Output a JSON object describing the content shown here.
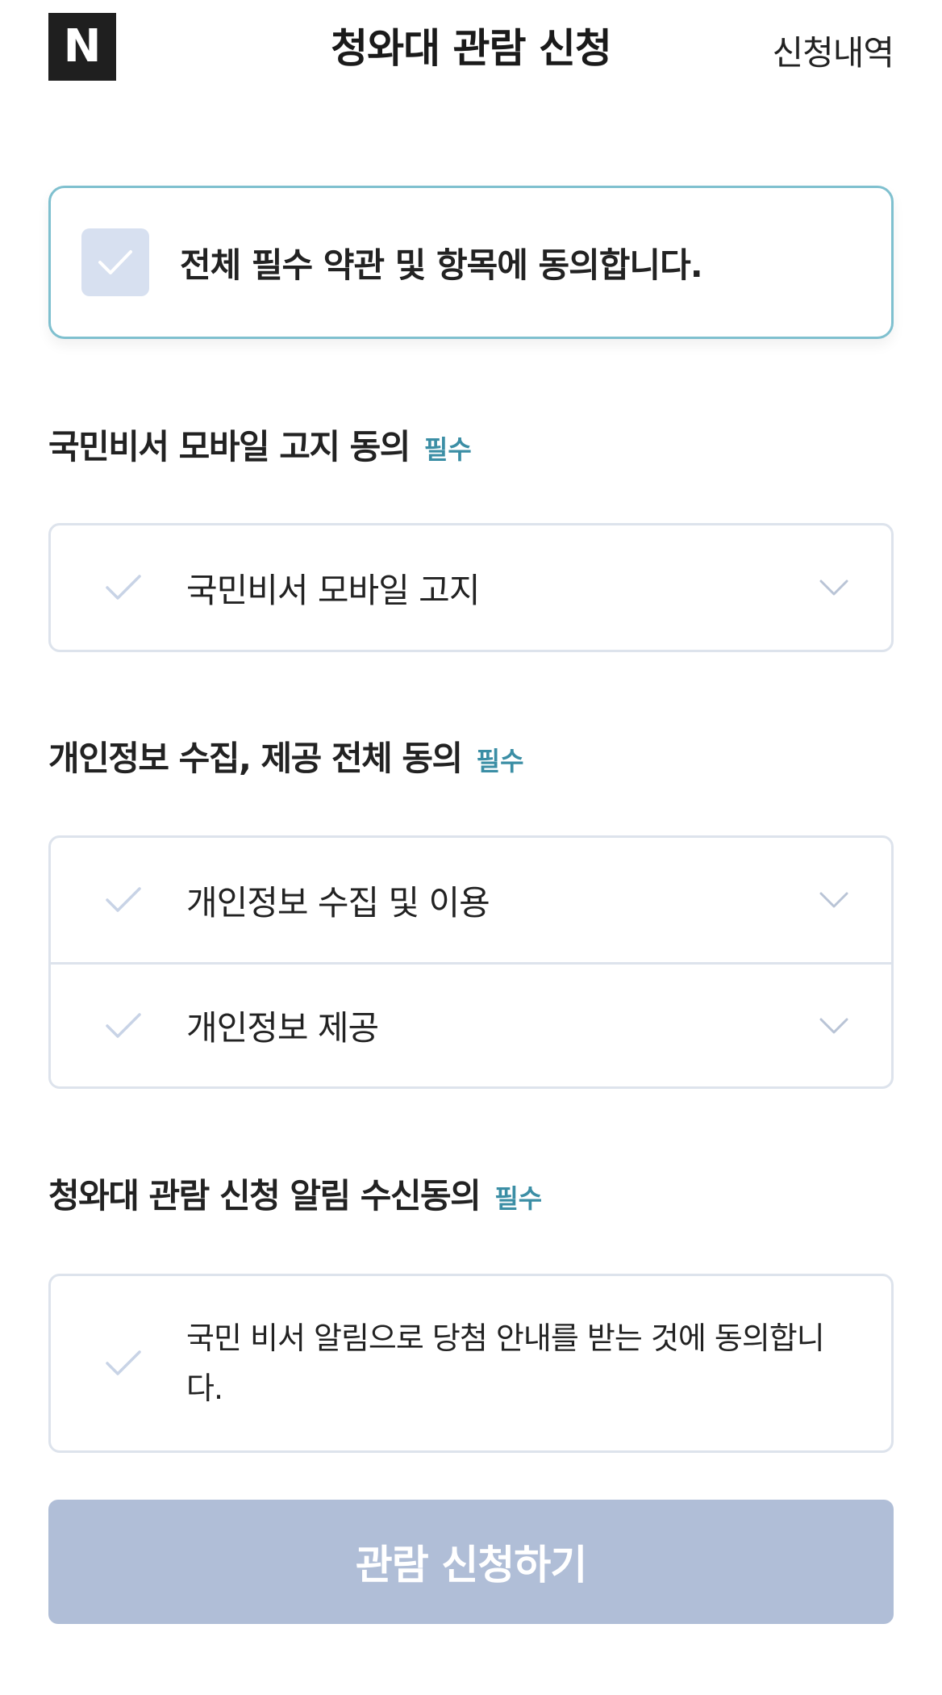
{
  "header": {
    "logo_letter": "N",
    "title": "청와대 관람 신청",
    "history_link": "신청내역"
  },
  "agree_all": {
    "label": "전체 필수 약관 및 항목에 동의합니다.",
    "checked": false
  },
  "sections": [
    {
      "heading": "국민비서 모바일 고지 동의",
      "required_label": "필수",
      "items": [
        {
          "label": "국민비서 모바일 고지",
          "icon": "chevron-down-icon"
        }
      ]
    },
    {
      "heading": "개인정보 수집, 제공 전체 동의",
      "required_label": "필수",
      "items": [
        {
          "label": "개인정보 수집 및 이용",
          "icon": "chevron-down-icon"
        },
        {
          "label": "개인정보 제공",
          "icon": "chevron-down-icon"
        }
      ]
    },
    {
      "heading": "청와대 관람 신청 알림 수신동의",
      "required_label": "필수",
      "items": [
        {
          "label": "국민 비서 알림으로 당첨 안내를 받는 것에 동의합니다."
        }
      ]
    }
  ],
  "submit": {
    "label": "관람 신청하기"
  },
  "colors": {
    "accent": "#3b8ea5",
    "agree_all_border": "#7fc0cf",
    "check_fill": "#d7e0f0",
    "check_mark": "#c8d3e6",
    "submit_disabled": "#b0bed7"
  }
}
